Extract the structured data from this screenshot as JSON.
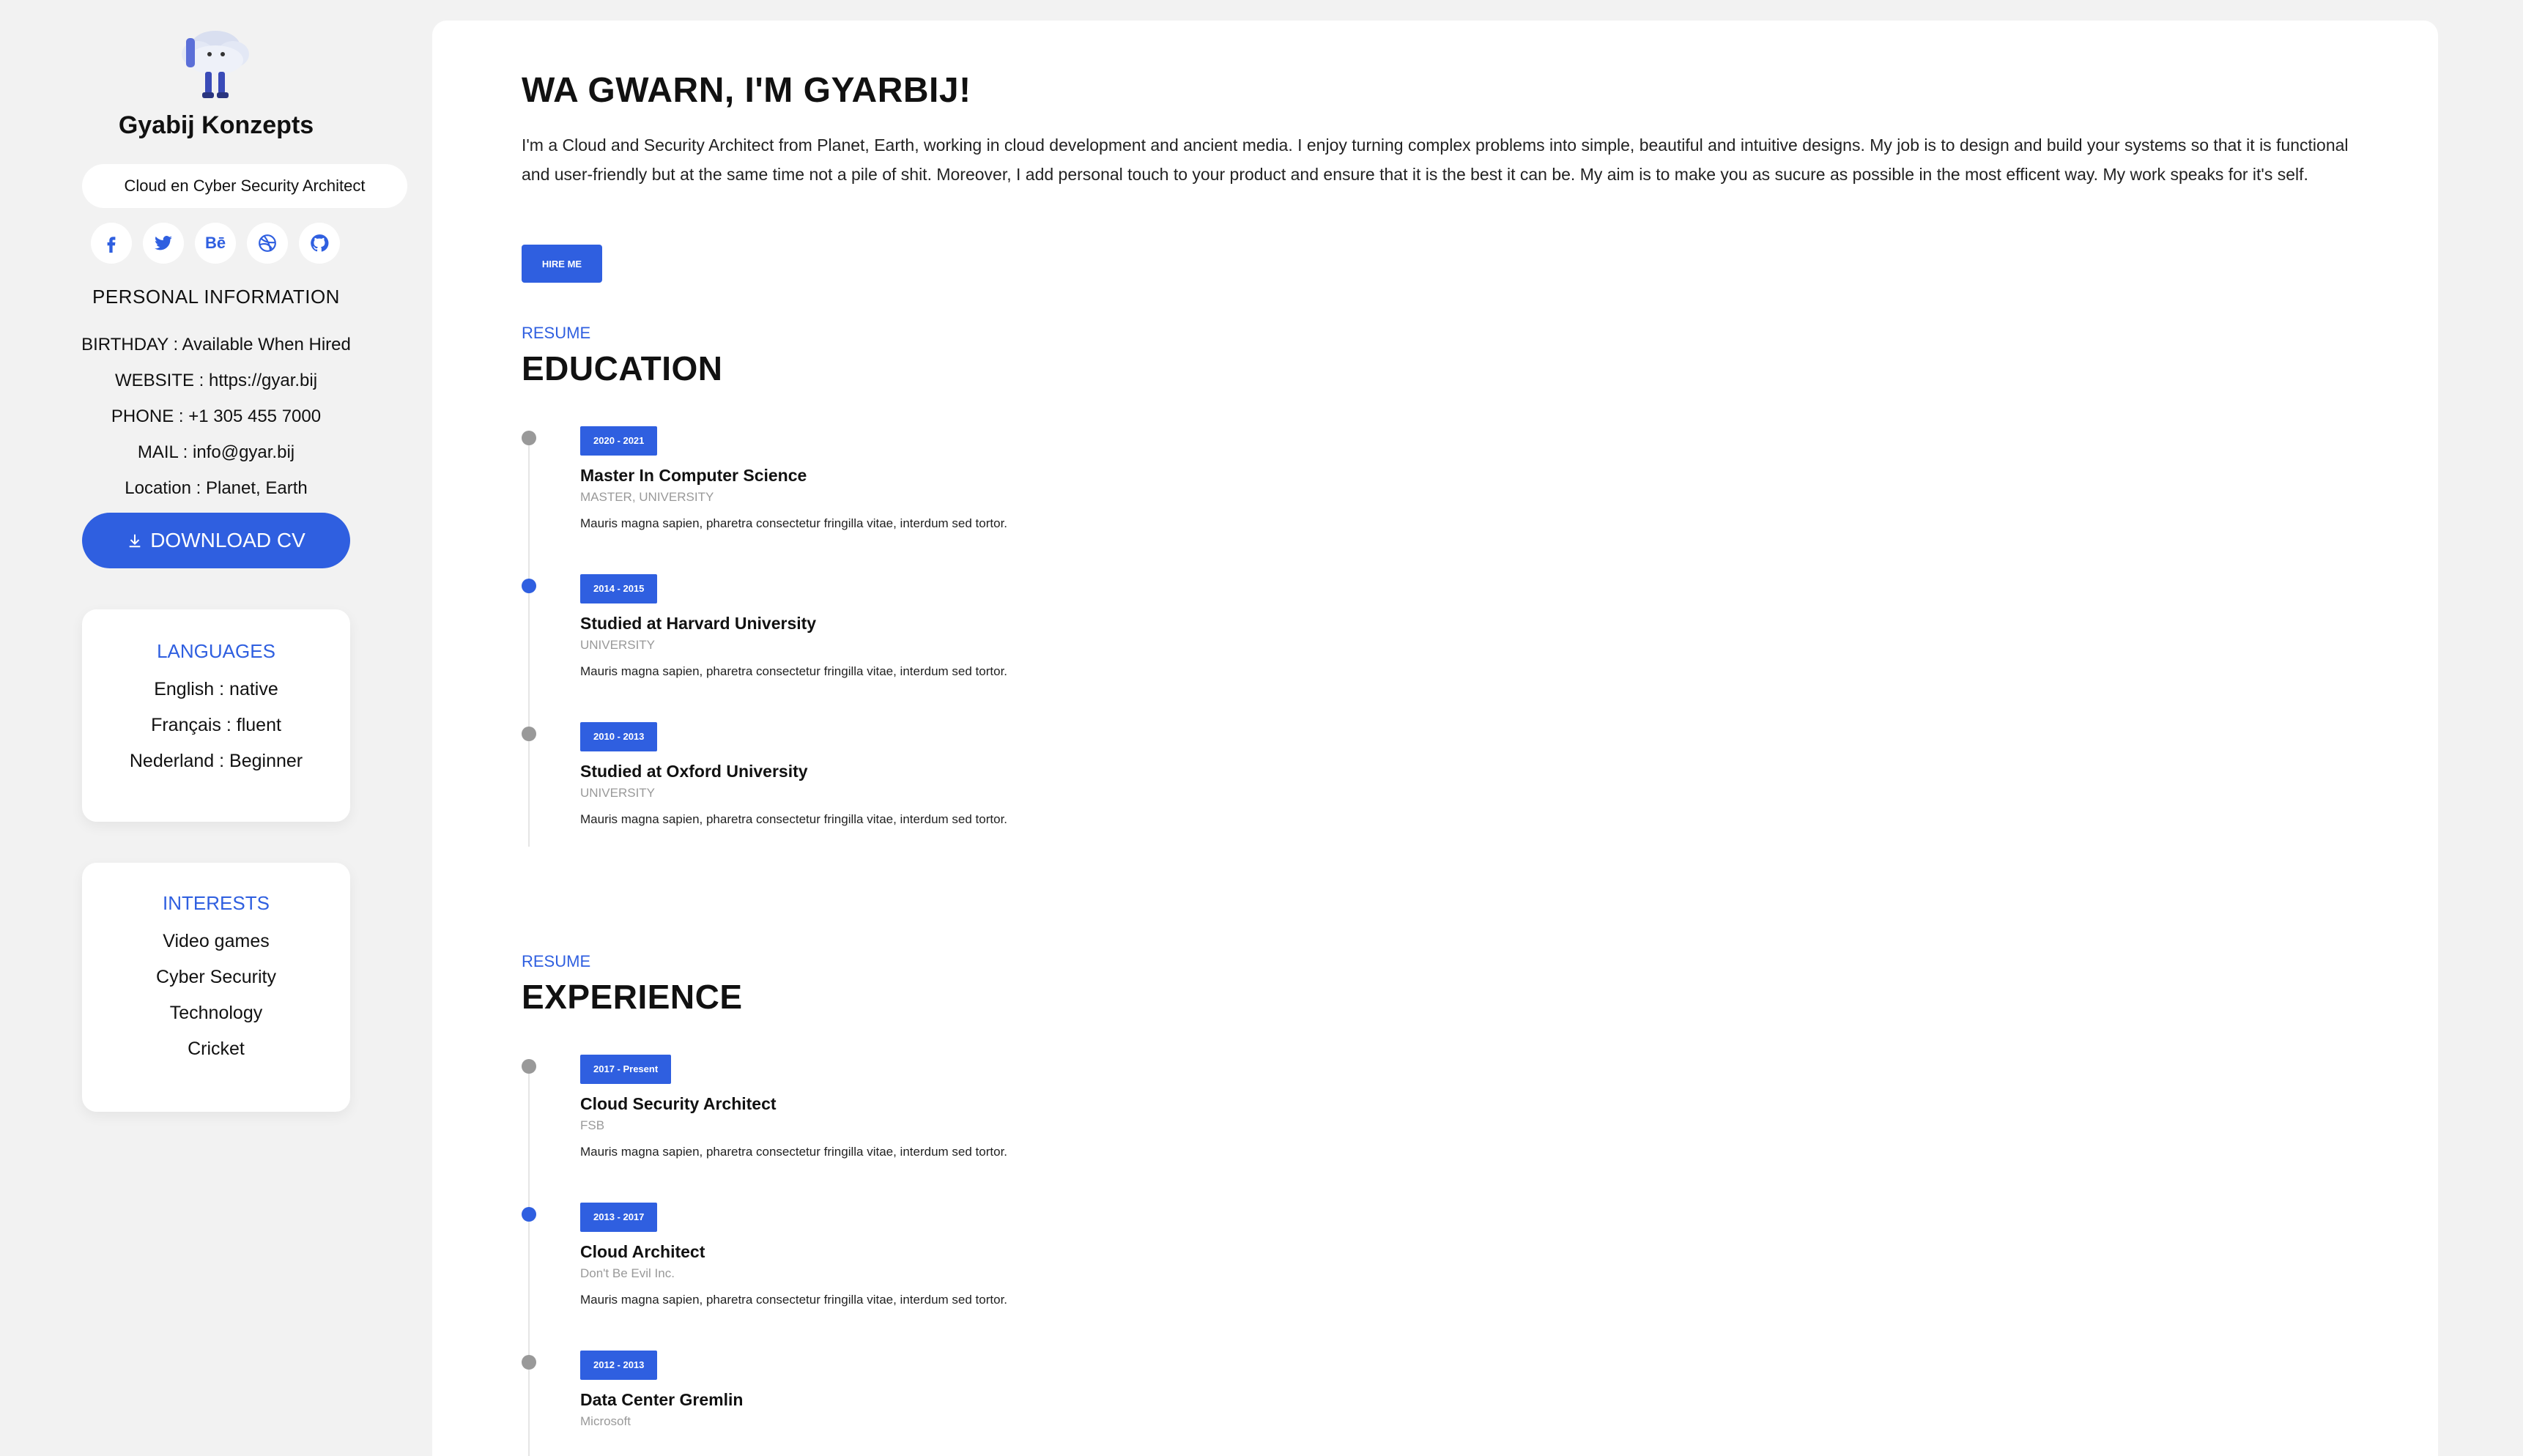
{
  "colors": {
    "accent": "#2f5fe0",
    "page_bg": "#f2f2f2",
    "card_bg": "#ffffff",
    "muted": "#999999"
  },
  "sidebar": {
    "brand": "Gyabij Konzepts",
    "tagline": "Cloud en Cyber Security Architect",
    "socials": [
      {
        "icon": "facebook-icon",
        "glyph": "f"
      },
      {
        "icon": "twitter-icon",
        "glyph": ""
      },
      {
        "icon": "behance-icon",
        "glyph": "Bē"
      },
      {
        "icon": "dribbble-icon",
        "glyph": ""
      },
      {
        "icon": "github-icon",
        "glyph": ""
      }
    ],
    "personal_info_title": "PERSONAL INFORMATION",
    "personal_info": [
      "BIRTHDAY : Available When Hired",
      "WEBSITE : https://gyar.bij",
      "PHONE : +1 305 455 7000",
      "MAIL : info@gyar.bij",
      "Location : Planet, Earth"
    ],
    "download_label": "DOWNLOAD CV",
    "languages": {
      "title": "LANGUAGES",
      "items": [
        "English : native",
        "Français : fluent",
        "Nederland : Beginner"
      ]
    },
    "interests": {
      "title": "INTERESTS",
      "items": [
        "Video games",
        "Cyber Security",
        "Technology",
        "Cricket"
      ]
    }
  },
  "main": {
    "hero_title": "WA GWARN, I'M GYARBIJ!",
    "hero_text": "I'm a Cloud and Security Architect from Planet, Earth, working in cloud development and ancient media. I enjoy turning complex problems into simple, beautiful and intuitive designs. My job is to design and build your systems so that it is functional and user-friendly but at the same time not a pile of shit. Moreover, I add personal touch to your product and ensure that it is the best it can be. My aim is to make you as sucure as possible in the most efficent way. My work speaks for it's self.",
    "hire_label": "HIRE ME",
    "education": {
      "eyebrow": "RESUME",
      "title": "EDUCATION",
      "items": [
        {
          "date": "2020 - 2021",
          "title": "Master In Computer Science",
          "subtitle": "MASTER, UNIVERSITY",
          "desc": "Mauris magna sapien, pharetra consectetur fringilla vitae, interdum sed tortor.",
          "active": false
        },
        {
          "date": "2014 - 2015",
          "title": "Studied at Harvard University",
          "subtitle": "UNIVERSITY",
          "desc": "Mauris magna sapien, pharetra consectetur fringilla vitae, interdum sed tortor.",
          "active": true
        },
        {
          "date": "2010 - 2013",
          "title": "Studied at Oxford University",
          "subtitle": "UNIVERSITY",
          "desc": "Mauris magna sapien, pharetra consectetur fringilla vitae, interdum sed tortor.",
          "active": false
        }
      ]
    },
    "experience": {
      "eyebrow": "RESUME",
      "title": "EXPERIENCE",
      "items": [
        {
          "date": "2017 - Present",
          "title": "Cloud Security Architect",
          "subtitle": "FSB",
          "desc": "Mauris magna sapien, pharetra consectetur fringilla vitae, interdum sed tortor.",
          "active": false
        },
        {
          "date": "2013 - 2017",
          "title": "Cloud Architect",
          "subtitle": "Don't Be Evil Inc.",
          "desc": "Mauris magna sapien, pharetra consectetur fringilla vitae, interdum sed tortor.",
          "active": true
        },
        {
          "date": "2012 - 2013",
          "title": "Data Center Gremlin",
          "subtitle": "Microsoft",
          "desc": "",
          "active": false
        }
      ]
    }
  }
}
